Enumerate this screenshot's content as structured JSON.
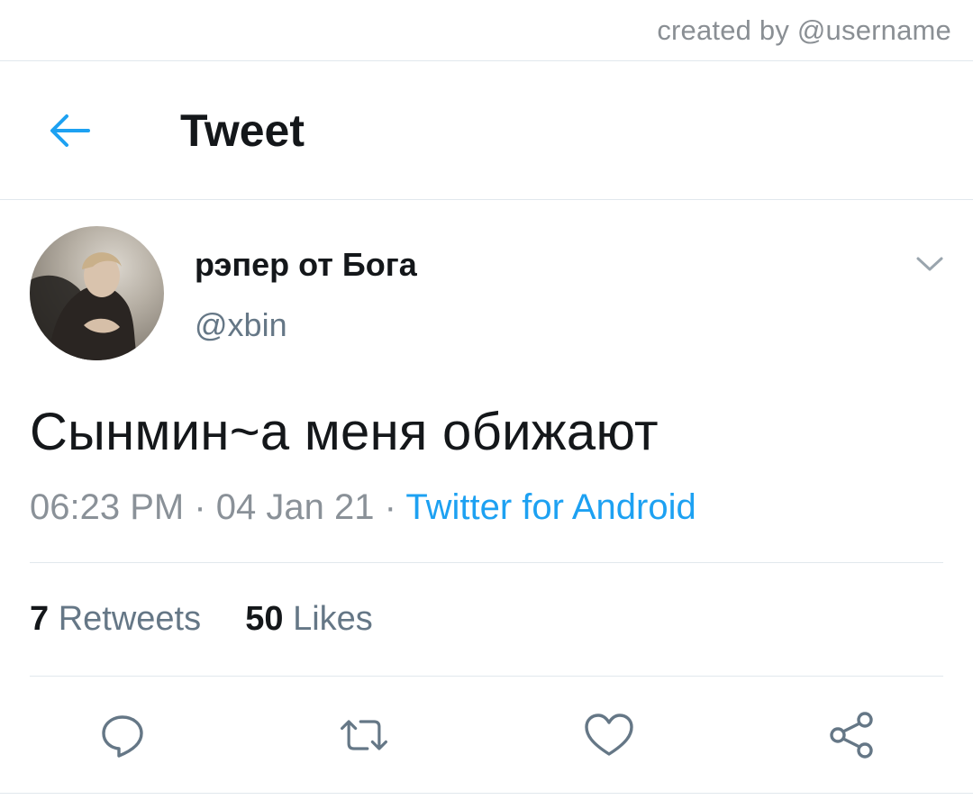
{
  "credit": "created by @username",
  "header": {
    "title": "Tweet",
    "back_icon": "arrow-left-icon"
  },
  "tweet": {
    "display_name": "рэпер от Бога",
    "handle": "@xbin",
    "text": "Сынмин~а меня обижают",
    "time": "06:23 PM",
    "date": "04 Jan 21",
    "source": "Twitter for Android",
    "separator": "·"
  },
  "stats": {
    "retweets_count": "7",
    "retweets_label": "Retweets",
    "likes_count": "50",
    "likes_label": "Likes"
  },
  "actions": [
    "reply-icon",
    "retweet-icon",
    "like-icon",
    "share-icon"
  ],
  "colors": {
    "accent": "#1da1f2",
    "text": "#14171a",
    "muted": "#657786",
    "border": "#e1e8ed",
    "icon": "#657786"
  }
}
